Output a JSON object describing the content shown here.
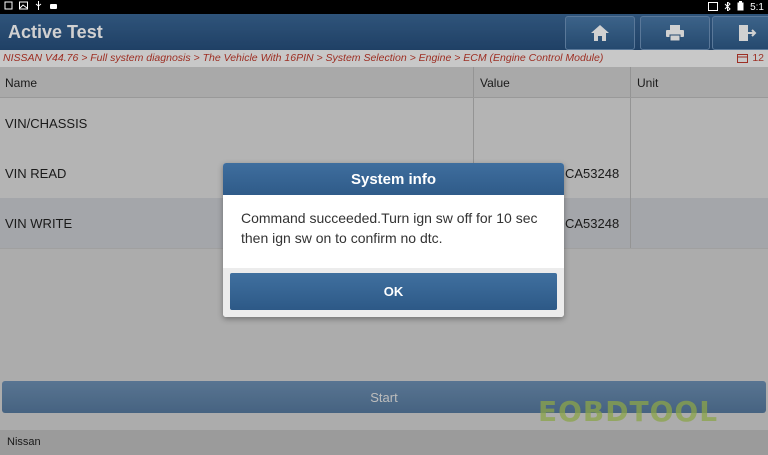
{
  "status_bar": {
    "time": "5:1"
  },
  "header": {
    "title": "Active Test"
  },
  "breadcrumb": {
    "path": "NISSAN V44.76 > Full system diagnosis > The Vehicle With 16PIN > System Selection > Engine > ECM (Engine Control Module)",
    "right_value": "12"
  },
  "table": {
    "columns": [
      "Name",
      "Value",
      "Unit"
    ],
    "rows": [
      {
        "name": "VIN/CHASSIS",
        "value": "",
        "unit": ""
      },
      {
        "name": "VIN READ",
        "value": "CA53248",
        "unit": ""
      },
      {
        "name": "VIN WRITE",
        "value": "CA53248",
        "unit": ""
      }
    ]
  },
  "start_button": {
    "label": "Start"
  },
  "footer": {
    "text": "Nissan"
  },
  "watermark": "EOBDTOOL",
  "dialog": {
    "title": "System info",
    "message": "Command  succeeded.Turn ign sw off for 10 sec then ign sw on to confirm no dtc.",
    "ok_label": "OK"
  },
  "colors": {
    "header_blue": "#2f5b89",
    "breadcrumb_red": "#c0392b"
  }
}
